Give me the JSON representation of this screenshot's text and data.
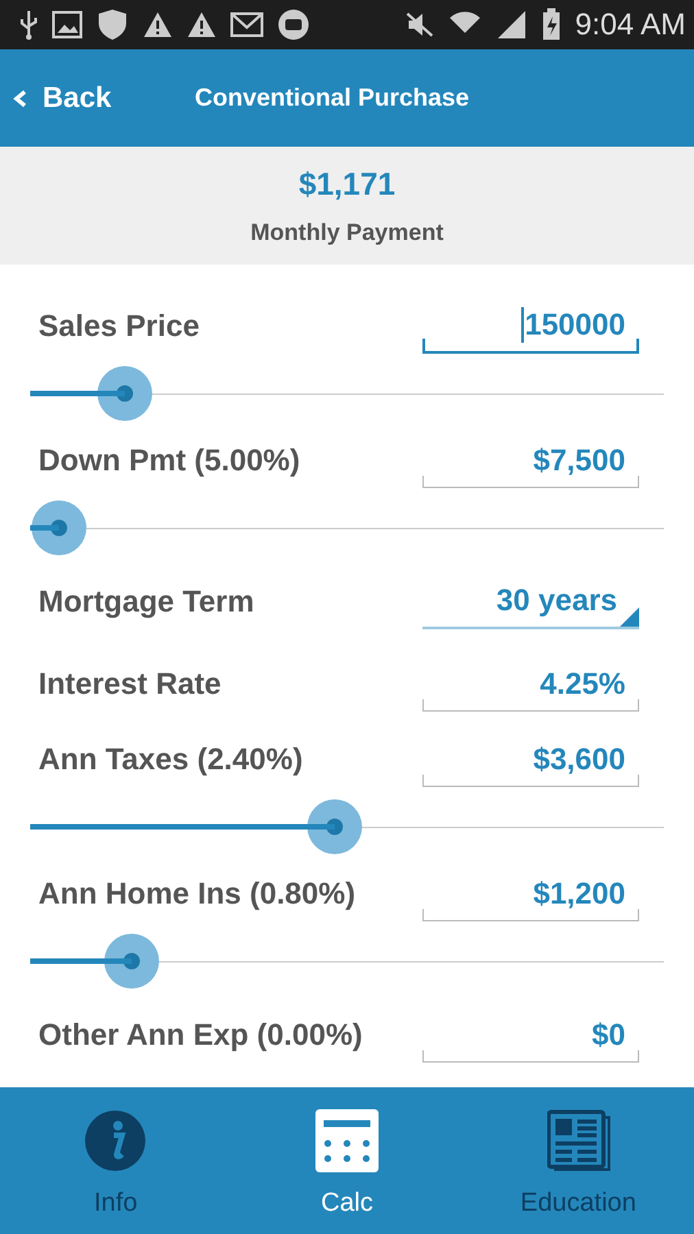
{
  "status_bar": {
    "time": "9:04 AM"
  },
  "header": {
    "back": "Back",
    "title": "Conventional Purchase"
  },
  "summary": {
    "amount": "$1,171",
    "label": "Monthly Payment"
  },
  "rows": [
    {
      "kind": "slider",
      "label": "Sales Price",
      "value": "150000",
      "focused": true,
      "level": 0.15
    },
    {
      "kind": "slider",
      "label": "Down Pmt (5.00%)",
      "value": "$7,500",
      "focused": false,
      "level": 0.045
    },
    {
      "kind": "dropdown",
      "label": "Mortgage Term",
      "value": "30 years"
    },
    {
      "kind": "field",
      "label": "Interest Rate",
      "value": "4.25%",
      "focused": false
    },
    {
      "kind": "slider",
      "label": "Ann Taxes (2.40%)",
      "value": "$3,600",
      "focused": false,
      "level": 0.48
    },
    {
      "kind": "slider",
      "label": "Ann Home Ins (0.80%)",
      "value": "$1,200",
      "focused": false,
      "level": 0.16
    },
    {
      "kind": "field",
      "label": "Other Ann Exp (0.00%)",
      "value": "$0",
      "focused": false
    }
  ],
  "nav": [
    {
      "kind": "info",
      "label": "Info",
      "selected": false
    },
    {
      "kind": "calc",
      "label": "Calc",
      "selected": true
    },
    {
      "kind": "education",
      "label": "Education",
      "selected": false
    }
  ]
}
